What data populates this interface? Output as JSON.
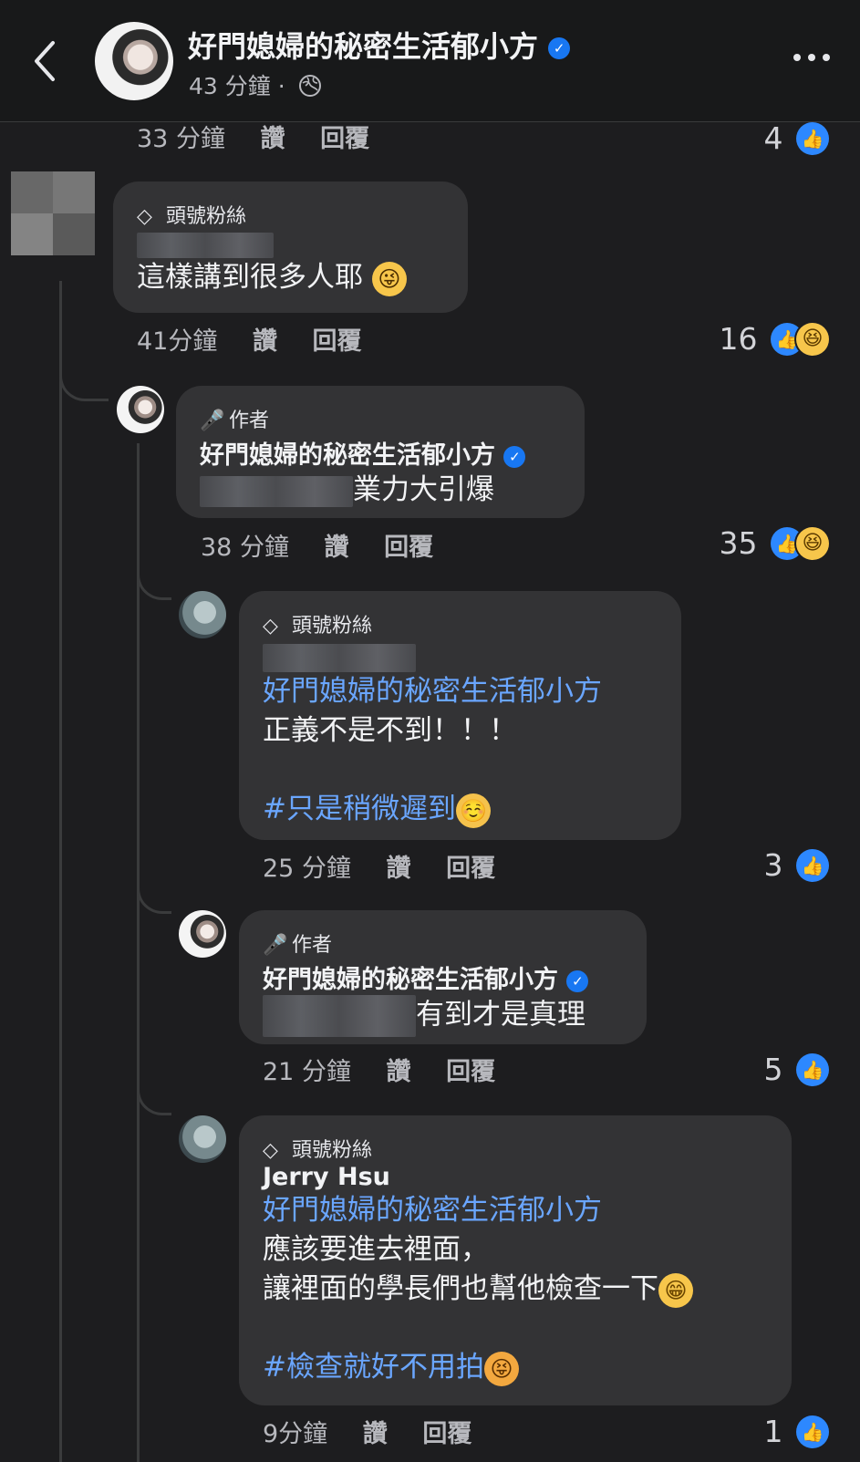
{
  "header": {
    "page_name": "好門媳婦的秘密生活郁小方",
    "verified_icon": "verified-check-icon",
    "time": "43 分鐘",
    "separator": "·",
    "privacy_icon": "globe-icon"
  },
  "actions": {
    "like": "讚",
    "reply": "回覆"
  },
  "comments": [
    {
      "time": "33 分鐘",
      "reaction_count": "4"
    },
    {
      "badge": "頭號粉絲",
      "text": "這樣講到很多人耶",
      "emoji": "😜",
      "time": "41分鐘",
      "reaction_count": "16"
    },
    {
      "badge": "作者",
      "name": "好門媳婦的秘密生活郁小方",
      "text": "業力大引爆",
      "time": "38 分鐘",
      "reaction_count": "35"
    },
    {
      "badge": "頭號粉絲",
      "mention": "好門媳婦的秘密生活郁小方",
      "text": "正義不是不到！！！",
      "hashtag": "#只是稍微遲到",
      "emoji": "☺️",
      "time": "25 分鐘",
      "reaction_count": "3"
    },
    {
      "badge": "作者",
      "name": "好門媳婦的秘密生活郁小方",
      "text": "有到才是真理",
      "time": "21 分鐘",
      "reaction_count": "5"
    },
    {
      "badge": "頭號粉絲",
      "name": "Jerry Hsu",
      "mention": "好門媳婦的秘密生活郁小方",
      "text_line_1": "應該要進去裡面，",
      "text_line_2": "讓裡面的學長們也幫他檢查一下",
      "hashtag": "#檢查就好不用拍",
      "emoji_1": "😁",
      "emoji_2": "😝",
      "time": "9分鐘",
      "reaction_count": "1"
    }
  ],
  "colors": {
    "background": "#1d1d1f",
    "bubble": "#333335",
    "link": "#6aa6ff",
    "like": "#2d88ff",
    "verified": "#1877f2"
  }
}
